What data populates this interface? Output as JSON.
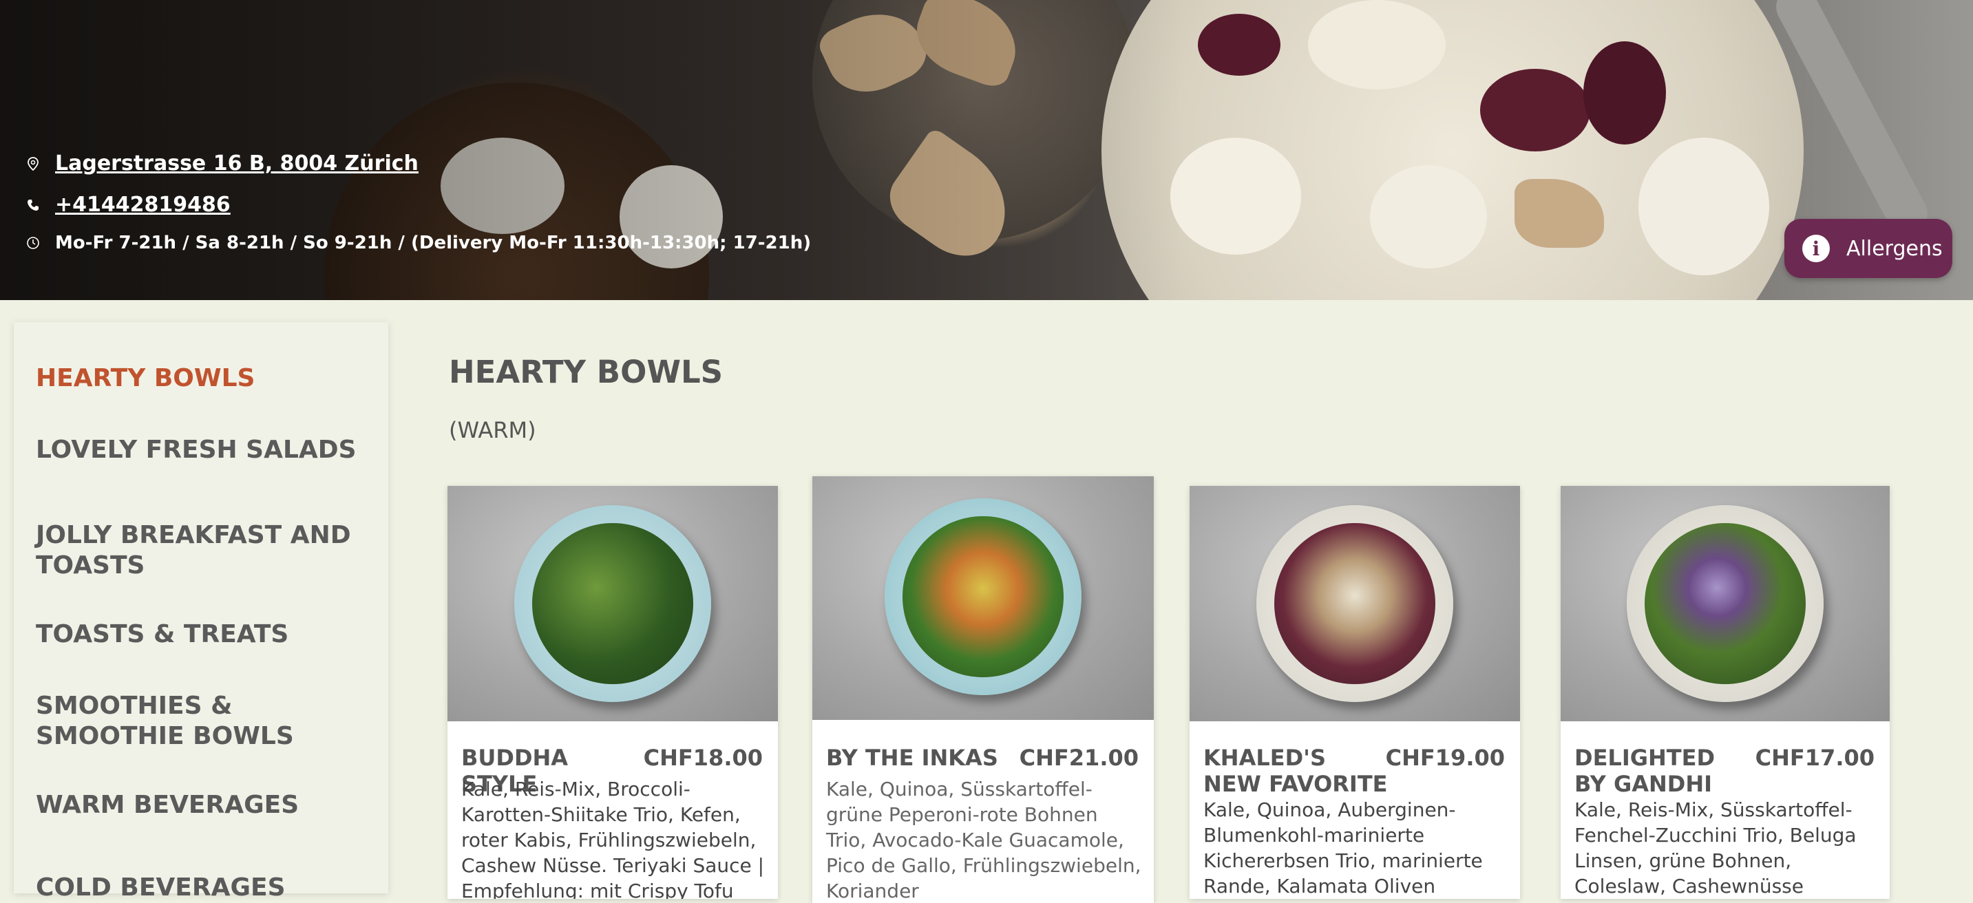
{
  "header": {
    "address": "Lagerstrasse 16 B, 8004 Zürich",
    "phone": "+41442819486",
    "hours": "Mo-Fr 7-21h / Sa 8-21h / So 9-21h / (Delivery Mo-Fr 11:30h-13:30h; 17-21h)",
    "icons": [
      "location-pin-icon",
      "phone-icon",
      "clock-icon"
    ]
  },
  "allergens_button": {
    "label": "Allergens",
    "icon": "info-icon",
    "color": "#6c2a52"
  },
  "sidebar": {
    "items": [
      {
        "label": "HEARTY BOWLS",
        "active": true
      },
      {
        "label": "LOVELY FRESH SALADS"
      },
      {
        "label": "JOLLY BREAKFAST AND TOASTS"
      },
      {
        "label": "TOASTS & TREATS"
      },
      {
        "label": "SMOOTHIES & SMOOTHIE BOWLS"
      },
      {
        "label": "WARM BEVERAGES"
      },
      {
        "label": "COLD BEVERAGES"
      }
    ],
    "active_color": "#c0532e"
  },
  "main": {
    "section_title": "HEARTY BOWLS",
    "section_subtitle": "(WARM)",
    "products": [
      {
        "name": "BUDDHA STYLE",
        "price": "CHF18.00",
        "description": "Kale, Reis-Mix, Broccoli-Karotten-Shiitake Trio, Kefen, roter Kabis, Frühlingszwiebeln, Cashew Nüsse. Teriyaki Sauce | Empfehlung: mit Crispy Tofu"
      },
      {
        "name": "BY THE INKAS",
        "price": "CHF21.00",
        "description": "Kale, Quinoa, Süsskartoffel-grüne Peperoni-rote Bohnen Trio, Avocado-Kale Guacamole, Pico de Gallo, Frühlingszwiebeln, Koriander"
      },
      {
        "name": "KHALED'S NEW FAVORITE",
        "price": "CHF19.00",
        "description": "Kale, Quinoa, Auberginen-Blumenkohl-marinierte Kichererbsen Trio, marinierte Rande, Kalamata Oliven"
      },
      {
        "name": "DELIGHTED BY GANDHI",
        "price": "CHF17.00",
        "description": "Kale, Reis-Mix, Süsskartoffel-Fenchel-Zucchini Trio, Beluga Linsen, grüne Bohnen, Coleslaw, Cashewnüsse"
      }
    ]
  }
}
